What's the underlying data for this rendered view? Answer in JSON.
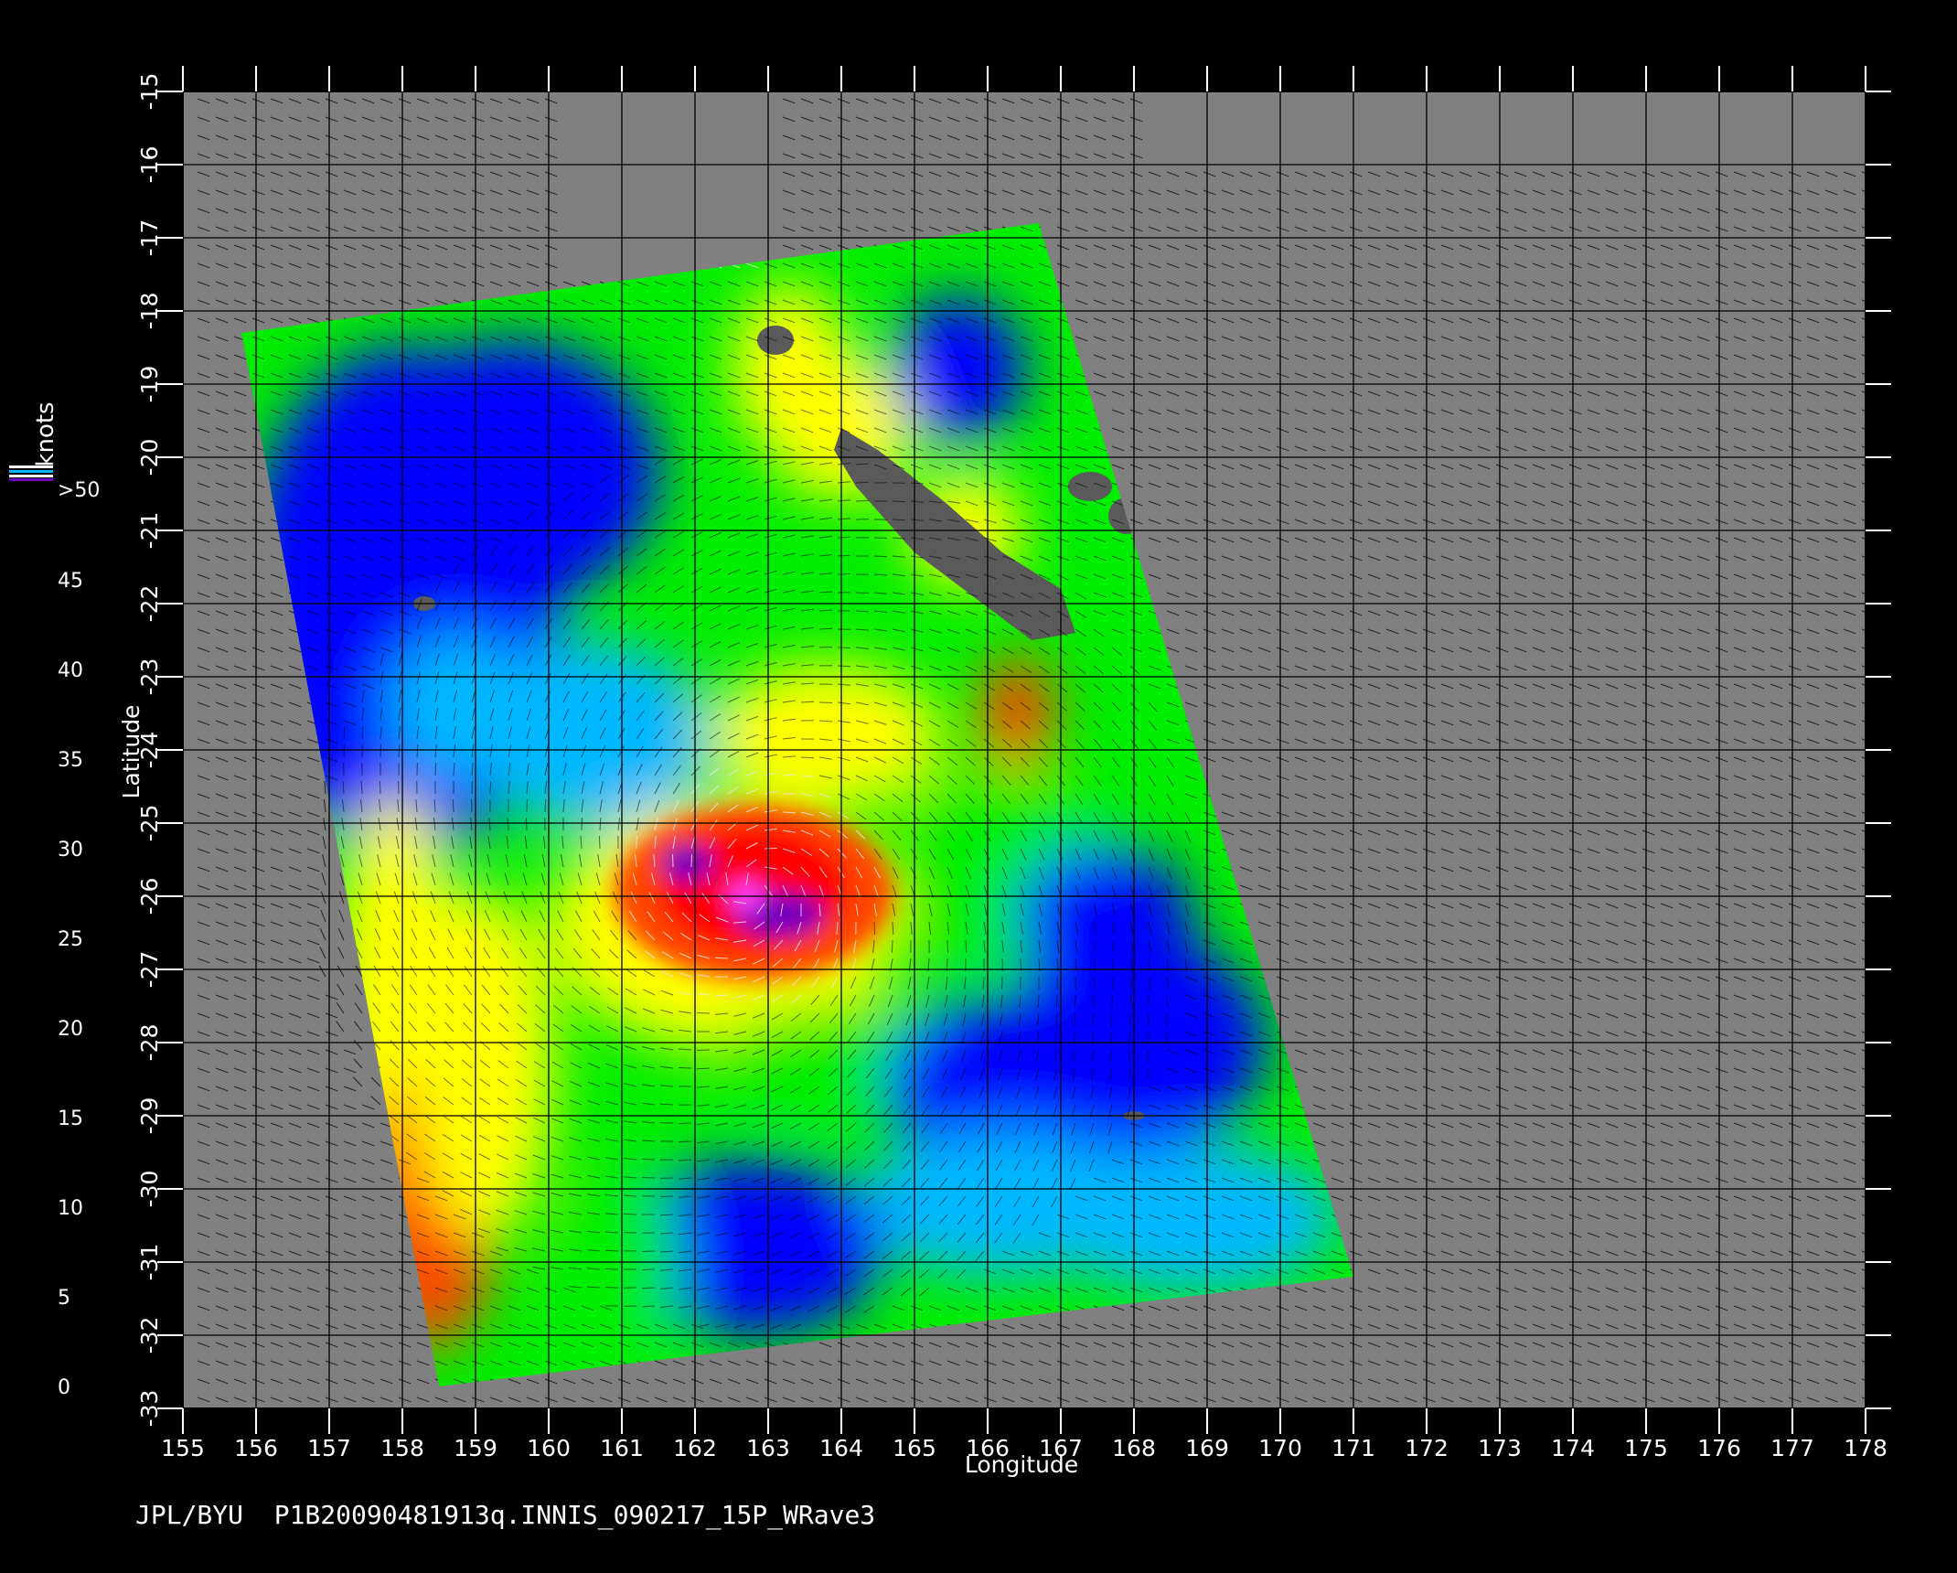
{
  "colors": {
    "background": "#000000",
    "land": "#808080",
    "island": "#5a5a5a",
    "grid": "#000000",
    "text": "#ffffff",
    "vectors_dark": "#000000",
    "vectors_light": "#e8e8e8"
  },
  "chart_data": {
    "type": "heatmap",
    "title": "",
    "xlabel": "Longitude",
    "ylabel": "Latitude",
    "xlim": [
      155,
      178
    ],
    "ylim": [
      -33,
      -15
    ],
    "x_ticks": [
      "155",
      "156",
      "157",
      "158",
      "159",
      "160",
      "161",
      "162",
      "163",
      "164",
      "165",
      "166",
      "167",
      "168",
      "169",
      "170",
      "171",
      "172",
      "173",
      "174",
      "175",
      "176",
      "177",
      "178"
    ],
    "y_ticks": [
      "-15",
      "-16",
      "-17",
      "-18",
      "-19",
      "-20",
      "-21",
      "-22",
      "-23",
      "-24",
      "-25",
      "-26",
      "-27",
      "-28",
      "-29",
      "-30",
      "-31",
      "-32",
      "-33"
    ],
    "grid": true,
    "colorbar": {
      "label": "knots",
      "ticks": [
        "0",
        "5",
        "10",
        "15",
        "20",
        "25",
        "30",
        "35",
        "40",
        "45",
        ">50"
      ],
      "ranges": [
        {
          "min": 0,
          "max": 5,
          "colors": [
            "#6e6e6e",
            "#3a3a3a"
          ]
        },
        {
          "min": 5,
          "max": 10,
          "colors": [
            "#00ffff",
            "#00b8ff"
          ]
        },
        {
          "min": 10,
          "max": 15,
          "colors": [
            "#0070ff",
            "#0000ff"
          ]
        },
        {
          "min": 15,
          "max": 20,
          "colors": [
            "#006000",
            "#00ee00"
          ]
        },
        {
          "min": 20,
          "max": 25,
          "colors": [
            "#ffc000",
            "#ffff00"
          ]
        },
        {
          "min": 25,
          "max": 30,
          "colors": [
            "#ff8000",
            "#ff4500"
          ]
        },
        {
          "min": 30,
          "max": 35,
          "colors": [
            "#ff2000",
            "#ff0000"
          ]
        },
        {
          "min": 35,
          "max": 40,
          "colors": [
            "#4a1a10",
            "#c08060"
          ]
        },
        {
          "min": 40,
          "max": 45,
          "colors": [
            "#ff00ff",
            "#ff40ff"
          ]
        },
        {
          "min": 45,
          "max": 50,
          "colors": [
            "#c000e0",
            "#7000c0"
          ]
        }
      ]
    },
    "swath_corners": [
      [
        155.8,
        -18.3
      ],
      [
        166.7,
        -16.8
      ],
      [
        171.0,
        -31.2
      ],
      [
        158.5,
        -32.7
      ]
    ],
    "storm_center": {
      "lon": 162.8,
      "lat": -25.9,
      "max_wind": 48
    }
  },
  "footer": {
    "text": "JPL/BYU  P1B20090481913q.INNIS_090217_15P_WRave3"
  }
}
